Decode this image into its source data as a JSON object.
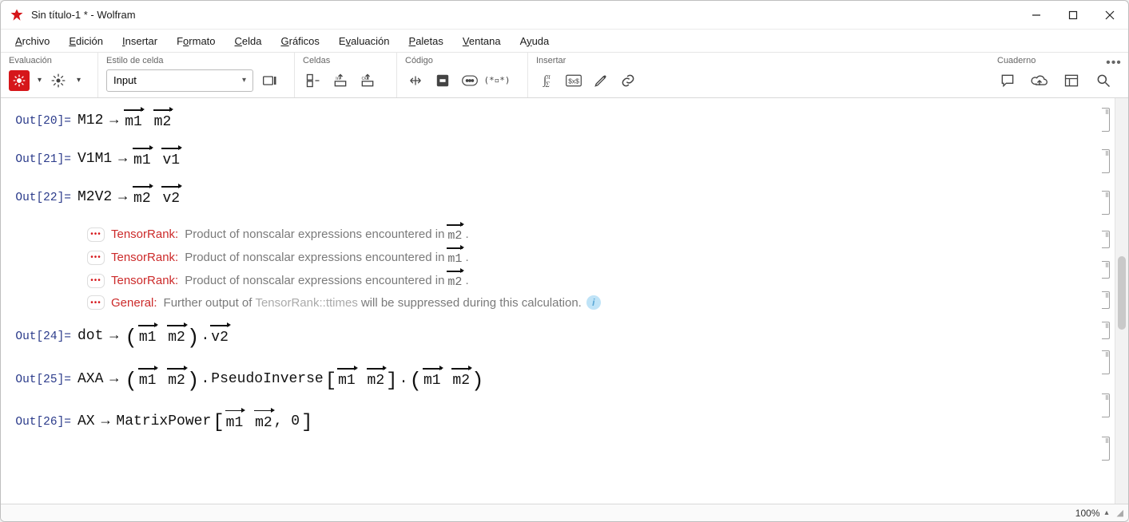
{
  "window": {
    "title": "Sin título-1 * - Wolfram"
  },
  "menu": {
    "archivo": "Archivo",
    "edicion": "Edición",
    "insertar": "Insertar",
    "formato": "Formato",
    "celda": "Celda",
    "graficos": "Gráficos",
    "evaluacion": "Evaluación",
    "paletas": "Paletas",
    "ventana": "Ventana",
    "ayuda": "Ayuda"
  },
  "toolbar": {
    "eval_label": "Evaluación",
    "style_label": "Estilo de celda",
    "style_value": "Input",
    "cells_label": "Celdas",
    "code_label": "Código",
    "insert_label": "Insertar",
    "notebook_label": "Cuaderno"
  },
  "outputs": {
    "o20": {
      "label": "Out[20]=",
      "lhs": "M12",
      "r1": "m1",
      "r2": "m2"
    },
    "o21": {
      "label": "Out[21]=",
      "lhs": "V1M1",
      "r1": "m1",
      "r2": "v1"
    },
    "o22": {
      "label": "Out[22]=",
      "lhs": "M2V2",
      "r1": "m2",
      "r2": "v2"
    },
    "o24": {
      "label": "Out[24]=",
      "lhs": "dot",
      "p1a": "m1",
      "p1b": "m2",
      "v": "v2"
    },
    "o25": {
      "label": "Out[25]=",
      "lhs": "AXA",
      "p1a": "m1",
      "p1b": "m2",
      "fn": "PseudoInverse",
      "b1a": "m1",
      "b1b": "m2",
      "p2a": "m1",
      "p2b": "m2"
    },
    "o26": {
      "label": "Out[26]=",
      "lhs": "AX",
      "fn": "MatrixPower",
      "a": "m1",
      "b": "m2",
      "tail": ", 0"
    }
  },
  "messages": {
    "tag1": "TensorRank",
    "colon": ":",
    "text_prefix": "Product of nonscalar expressions encountered in ",
    "m2": "m2",
    "m1": "m1",
    "gtag": "General",
    "gtext_a": "Further output of ",
    "gtext_b": "TensorRank::ttimes",
    "gtext_c": " will be suppressed during this calculation."
  },
  "status": {
    "zoom": "100%"
  }
}
